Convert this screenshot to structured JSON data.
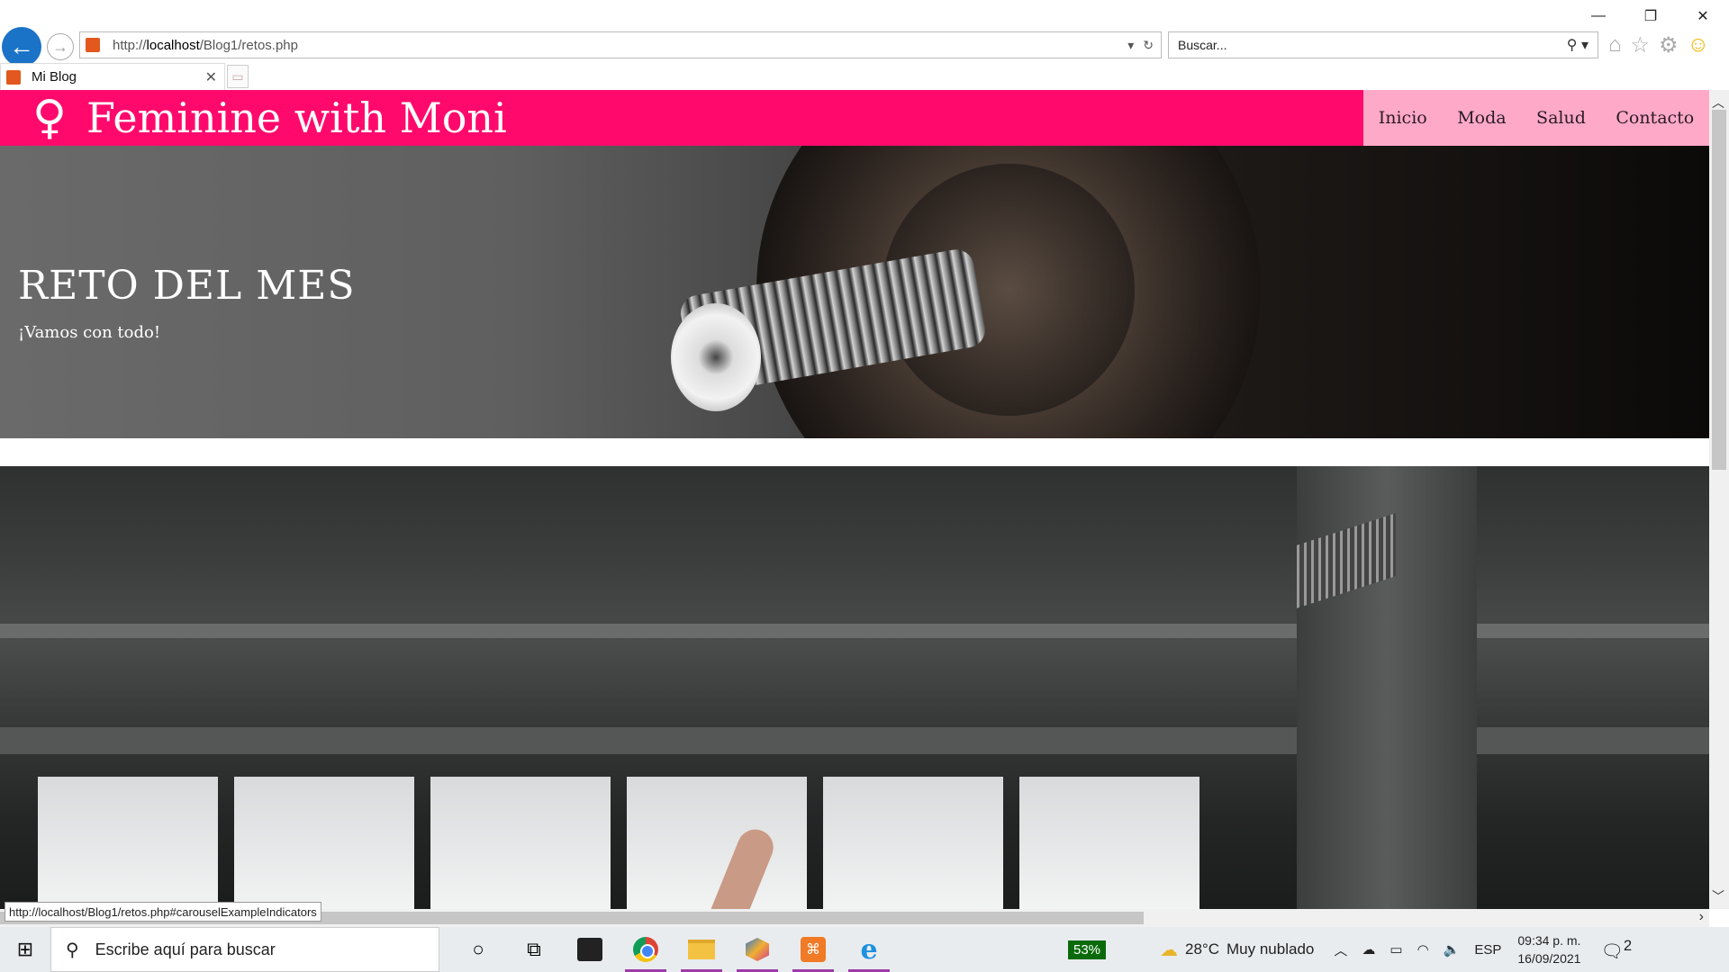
{
  "browser": {
    "window_controls": {
      "minimize": "—",
      "restore": "❐",
      "close": "✕"
    },
    "address": {
      "prefix": "http://",
      "host": "localhost",
      "path": "/Blog1/retos.php"
    },
    "search": {
      "placeholder": "Buscar..."
    },
    "tab": {
      "title": "Mi Blog"
    }
  },
  "site": {
    "brand": {
      "symbol": "♀",
      "name": "Feminine with Moni"
    },
    "nav": [
      "Inicio",
      "Moda",
      "Salud",
      "Contacto"
    ],
    "hero": {
      "title": "RETO DEL MES",
      "subtitle": "¡Vamos con todo!"
    }
  },
  "status_url": "http://localhost/Blog1/retos.php#carouselExampleIndicators",
  "taskbar": {
    "search_placeholder": "Escribe aquí para buscar",
    "battery": "53%",
    "weather": {
      "temp": "28°C",
      "desc": "Muy nublado"
    },
    "lang": "ESP",
    "time": "09:34 p. m.",
    "date": "16/09/2021",
    "notifications": "2"
  },
  "colors": {
    "header": "#ff0a6c",
    "nav_bg": "#ffa9c9"
  }
}
